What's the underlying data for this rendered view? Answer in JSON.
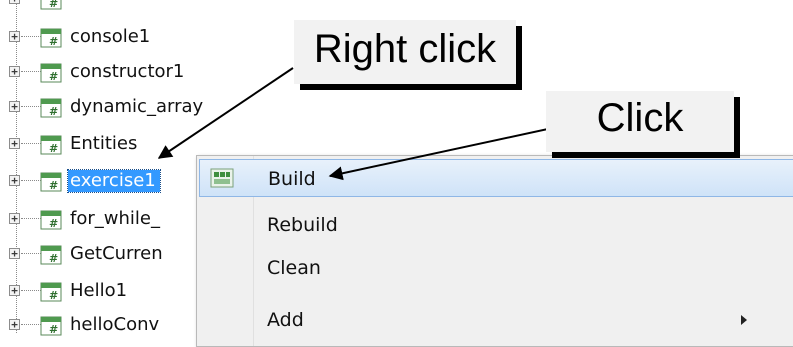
{
  "tree": {
    "items": [
      {
        "label": "",
        "expander": "+"
      },
      {
        "label": "console1",
        "expander": "+"
      },
      {
        "label": "constructor1",
        "expander": "+"
      },
      {
        "label": "dynamic_array",
        "expander": "+"
      },
      {
        "label": "Entities",
        "expander": "+"
      },
      {
        "label": "exercise1",
        "expander": "+",
        "selected": true
      },
      {
        "label": "for_while_",
        "expander": "+"
      },
      {
        "label": "GetCurren",
        "expander": "+"
      },
      {
        "label": "Hello1",
        "expander": "+"
      },
      {
        "label": "helloConv",
        "expander": "+"
      }
    ]
  },
  "context_menu": {
    "items": [
      {
        "label": "Build",
        "highlighted": true,
        "icon": "build-icon"
      },
      {
        "label": "Rebuild"
      },
      {
        "label": "Clean"
      },
      {
        "label": "Add",
        "has_submenu": true
      }
    ]
  },
  "annotations": {
    "right_click": "Right click",
    "click": "Click"
  },
  "colors": {
    "selection": "#3399ff",
    "menu_background": "#f0f0f0",
    "menu_highlight": "#cfe3f8",
    "callout_background": "#f2f2f2"
  }
}
